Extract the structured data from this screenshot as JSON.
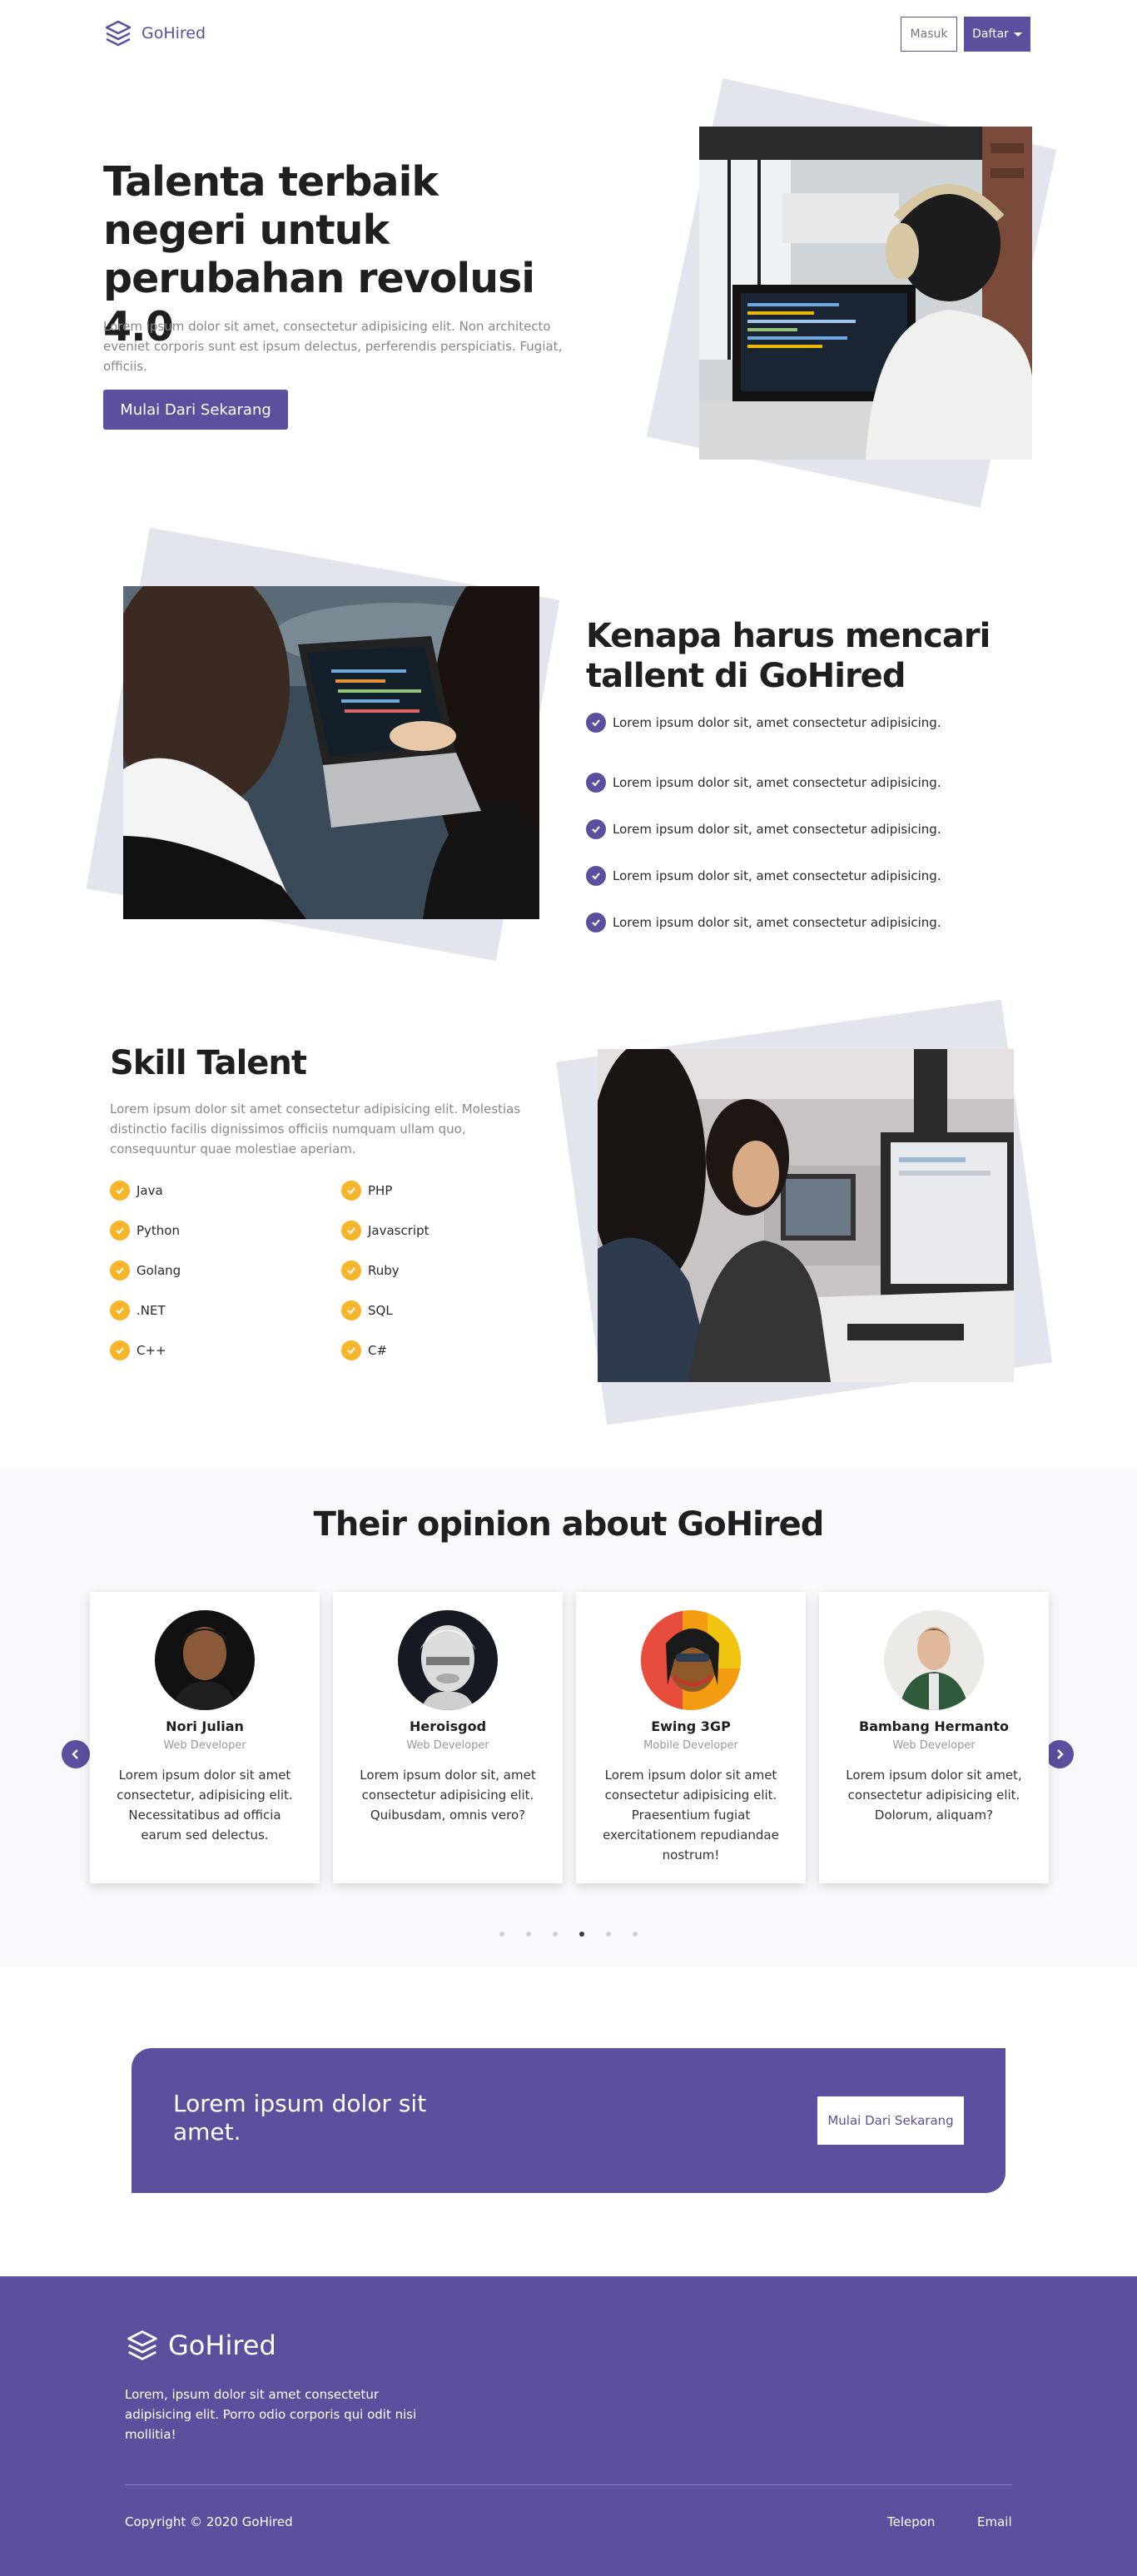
{
  "nav": {
    "brand": "GoHired",
    "login_label": "Masuk",
    "register_label": "Daftar"
  },
  "hero": {
    "title": "Talenta terbaik negeri untuk perubahan revolusi 4.0",
    "description": "Lorem ipsum dolor sit amet, consectetur adipisicing elit. Non architecto eveniet corporis sunt est ipsum delectus, perferendis perspiciatis. Fugiat, officiis.",
    "cta_label": "Mulai Dari Sekarang"
  },
  "why": {
    "title": "Kenapa harus mencari tallent di GoHired",
    "items": [
      "Lorem ipsum dolor sit, amet consectetur adipisicing.",
      "Lorem ipsum dolor sit, amet consectetur adipisicing.",
      "Lorem ipsum dolor sit, amet consectetur adipisicing.",
      "Lorem ipsum dolor sit, amet consectetur adipisicing.",
      "Lorem ipsum dolor sit, amet consectetur adipisicing."
    ]
  },
  "skills": {
    "title": "Skill Talent",
    "description": "Lorem ipsum dolor sit amet consectetur adipisicing elit. Molestias distinctio facilis dignissimos officiis numquam ullam quo, consequuntur quae molestiae aperiam.",
    "items": [
      "Java",
      "PHP",
      "Python",
      "Javascript",
      "Golang",
      "Ruby",
      ".NET",
      "SQL",
      "C++",
      "C#"
    ]
  },
  "testimonials": {
    "title": "Their opinion about GoHired",
    "cards": [
      {
        "name": "Nori Julian",
        "role": "Web Developer",
        "text": "Lorem ipsum dolor sit amet consectetur, adipisicing elit. Necessitatibus ad officia earum sed delectus."
      },
      {
        "name": "Heroisgod",
        "role": "Web Developer",
        "text": "Lorem ipsum dolor sit, amet consectetur adipisicing elit. Quibusdam, omnis vero?"
      },
      {
        "name": "Ewing 3GP",
        "role": "Mobile Developer",
        "text": "Lorem ipsum dolor sit amet consectetur adipisicing elit. Praesentium fugiat exercitationem repudiandae nostrum!"
      },
      {
        "name": "Bambang Hermanto",
        "role": "Web Developer",
        "text": "Lorem ipsum dolor sit amet, consectetur adipisicing elit. Dolorum, aliquam?"
      }
    ],
    "dots_count": 6,
    "active_dot": 4
  },
  "cta": {
    "text": "Lorem ipsum dolor sit amet.",
    "button_label": "Mulai Dari Sekarang"
  },
  "footer": {
    "brand": "GoHired",
    "description": "Lorem, ipsum dolor sit amet consectetur adipisicing elit. Porro odio corporis qui odit nisi mollitia!",
    "copyright": "Copyright © 2020 GoHired",
    "links": [
      "Telepon",
      "Email"
    ]
  },
  "colors": {
    "primary": "#5c4f9e",
    "accent_yellow": "#f7b52b",
    "tilt_gray": "#e3e5ec"
  }
}
